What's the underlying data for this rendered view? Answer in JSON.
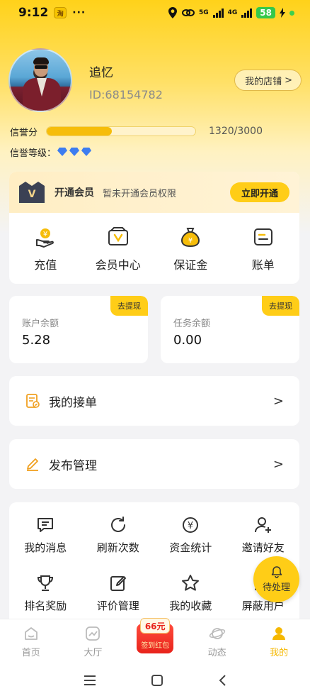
{
  "status_bar": {
    "time": "9:12",
    "notification_badge": "淘",
    "dots": "···",
    "network_1": "5G",
    "network_2": "4G",
    "battery": "58"
  },
  "profile": {
    "username": "追忆",
    "user_id": "ID:68154782",
    "shop_button": "我的店铺",
    "shop_chevron": ">"
  },
  "credit": {
    "label": "信誉分",
    "current": 1320,
    "max": 3000,
    "value_text": "1320/3000",
    "level_label": "信誉等级：",
    "level_diamonds": 3
  },
  "vip": {
    "logo_letter": "V",
    "title": "开通会员",
    "desc": "暂未开通会员权限",
    "button": "立即开通"
  },
  "quick_actions": [
    {
      "label": "充值",
      "icon": "recharge-icon"
    },
    {
      "label": "会员中心",
      "icon": "vip-center-icon"
    },
    {
      "label": "保证金",
      "icon": "deposit-icon"
    },
    {
      "label": "账单",
      "icon": "bill-icon"
    }
  ],
  "balances": {
    "withdraw_tag": "去提现",
    "account": {
      "label": "账户余额",
      "value": "5.28"
    },
    "task": {
      "label": "任务余额",
      "value": "0.00"
    }
  },
  "menu": {
    "my_orders": "我的接单",
    "publish_management": "发布管理",
    "chevron": ">"
  },
  "grid_items": [
    {
      "label": "我的消息",
      "icon": "message-icon"
    },
    {
      "label": "刷新次数",
      "icon": "refresh-icon"
    },
    {
      "label": "资金统计",
      "icon": "funds-icon"
    },
    {
      "label": "邀请好友",
      "icon": "invite-user-icon"
    },
    {
      "label": "排名奖励",
      "icon": "trophy-icon"
    },
    {
      "label": "评价管理",
      "icon": "edit-review-icon"
    },
    {
      "label": "我的收藏",
      "icon": "star-icon"
    },
    {
      "label": "屏蔽用户",
      "icon": "block-user-icon"
    }
  ],
  "pending": {
    "label": "待处理"
  },
  "tabbar": {
    "home": "首页",
    "hall": "大厅",
    "redpacket_amount": "66元",
    "redpacket_label": "签到红包",
    "dynamics": "动态",
    "mine": "我的"
  },
  "colors": {
    "accent": "#ffcd17",
    "accent_text": "#f5b800",
    "diamond": "#3d7df0",
    "icon_orange": "#f0a020"
  }
}
